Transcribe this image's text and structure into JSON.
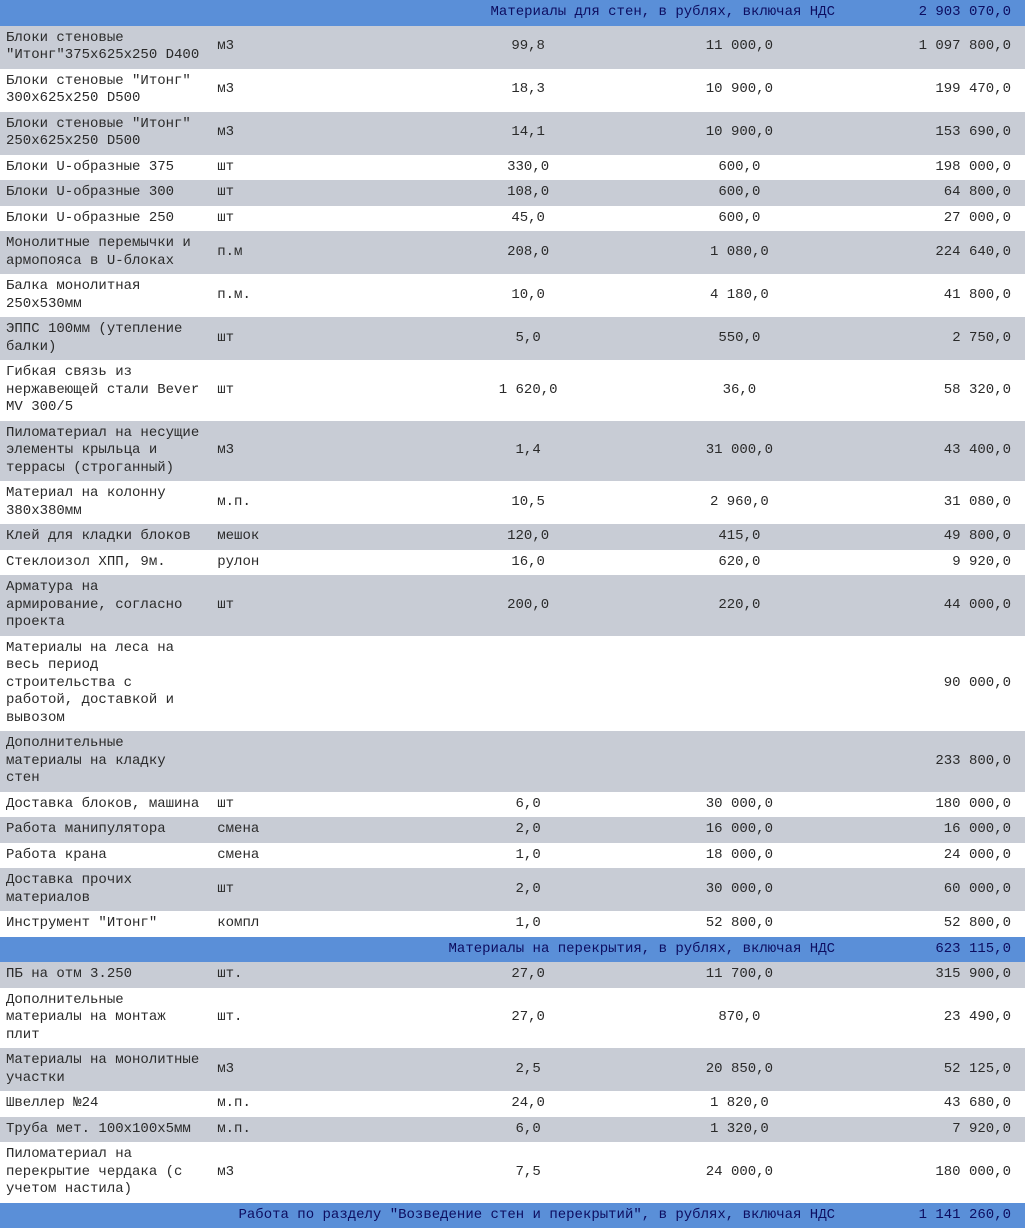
{
  "sections": [
    {
      "title": "Материалы для стен, в рублях, включая НДС",
      "total": "2 903 070,0",
      "rows": [
        {
          "name": "Блоки стеновые \"Итонг\"375х625х250 D400",
          "unit": "м3",
          "qty": "99,8",
          "price": "11 000,0",
          "sum": "1 097 800,0"
        },
        {
          "name": "Блоки стеновые \"Итонг\" 300х625х250 D500",
          "unit": "м3",
          "qty": "18,3",
          "price": "10 900,0",
          "sum": "199 470,0"
        },
        {
          "name": "Блоки стеновые \"Итонг\" 250х625х250 D500",
          "unit": "м3",
          "qty": "14,1",
          "price": "10 900,0",
          "sum": "153 690,0"
        },
        {
          "name": "Блоки U-образные 375",
          "unit": "шт",
          "qty": "330,0",
          "price": "600,0",
          "sum": "198 000,0"
        },
        {
          "name": "Блоки U-образные 300",
          "unit": "шт",
          "qty": "108,0",
          "price": "600,0",
          "sum": "64 800,0"
        },
        {
          "name": "Блоки U-образные 250",
          "unit": "шт",
          "qty": "45,0",
          "price": "600,0",
          "sum": "27 000,0"
        },
        {
          "name": "Монолитные перемычки и армопояса в U-блоках",
          "unit": "п.м",
          "qty": "208,0",
          "price": "1 080,0",
          "sum": "224 640,0"
        },
        {
          "name": "Балка монолитная 250х530мм",
          "unit": "п.м.",
          "qty": "10,0",
          "price": "4 180,0",
          "sum": "41 800,0"
        },
        {
          "name": "ЭППС 100мм (утепление балки)",
          "unit": "шт",
          "qty": "5,0",
          "price": "550,0",
          "sum": "2 750,0"
        },
        {
          "name": "Гибкая связь из нержавеющей стали Bever MV 300/5",
          "unit": "шт",
          "qty": "1 620,0",
          "price": "36,0",
          "sum": "58 320,0"
        },
        {
          "name": "Пиломатериал на несущие элементы крыльца и террасы (строганный)",
          "unit": "м3",
          "qty": "1,4",
          "price": "31 000,0",
          "sum": "43 400,0"
        },
        {
          "name": "Материал на колонну 380х380мм",
          "unit": "м.п.",
          "qty": "10,5",
          "price": "2 960,0",
          "sum": "31 080,0"
        },
        {
          "name": "Клей для кладки блоков",
          "unit": "мешок",
          "qty": "120,0",
          "price": "415,0",
          "sum": "49 800,0"
        },
        {
          "name": "Стеклоизол ХПП, 9м.",
          "unit": "рулон",
          "qty": "16,0",
          "price": "620,0",
          "sum": "9 920,0"
        },
        {
          "name": "Арматура на армирование, согласно проекта",
          "unit": "шт",
          "qty": "200,0",
          "price": "220,0",
          "sum": "44 000,0"
        },
        {
          "name": "Материалы на леса на весь период строительства с работой, доставкой и вывозом",
          "unit": "",
          "qty": "",
          "price": "",
          "sum": "90 000,0"
        },
        {
          "name": "Дополнительные материалы на кладку стен",
          "unit": "",
          "qty": "",
          "price": "",
          "sum": "233 800,0"
        },
        {
          "name": "Доставка блоков, машина",
          "unit": "шт",
          "qty": "6,0",
          "price": "30 000,0",
          "sum": "180 000,0"
        },
        {
          "name": "Работа манипулятора",
          "unit": "смена",
          "qty": "2,0",
          "price": "16 000,0",
          "sum": "16 000,0"
        },
        {
          "name": "Работа крана",
          "unit": "смена",
          "qty": "1,0",
          "price": "18 000,0",
          "sum": "24 000,0"
        },
        {
          "name": "Доставка прочих материалов",
          "unit": "шт",
          "qty": "2,0",
          "price": "30 000,0",
          "sum": "60 000,0"
        },
        {
          "name": "Инструмент \"Итонг\"",
          "unit": "компл",
          "qty": "1,0",
          "price": "52 800,0",
          "sum": "52 800,0"
        }
      ]
    },
    {
      "title": "Материалы на перекрытия, в рублях, включая НДС",
      "total": "623 115,0",
      "rows": [
        {
          "name": "ПБ на отм 3.250",
          "unit": "шт.",
          "qty": "27,0",
          "price": "11 700,0",
          "sum": "315 900,0"
        },
        {
          "name": "Дополнительные материалы на монтаж плит",
          "unit": "шт.",
          "qty": "27,0",
          "price": "870,0",
          "sum": "23 490,0"
        },
        {
          "name": "Материалы на монолитные участки",
          "unit": "м3",
          "qty": "2,5",
          "price": "20 850,0",
          "sum": "52 125,0"
        },
        {
          "name": "Швеллер №24",
          "unit": "м.п.",
          "qty": "24,0",
          "price": "1 820,0",
          "sum": "43 680,0"
        },
        {
          "name": "Труба мет. 100х100х5мм",
          "unit": "м.п.",
          "qty": "6,0",
          "price": "1 320,0",
          "sum": "7 920,0"
        },
        {
          "name": "Пиломатериал на перекрытие чердака (с учетом настила)",
          "unit": "м3",
          "qty": "7,5",
          "price": "24 000,0",
          "sum": "180 000,0"
        }
      ]
    },
    {
      "title": "Работа по разделу \"Возведение стен и перекрытий\", в рублях, включая НДС",
      "total": "1 141 260,0",
      "rows": []
    }
  ]
}
